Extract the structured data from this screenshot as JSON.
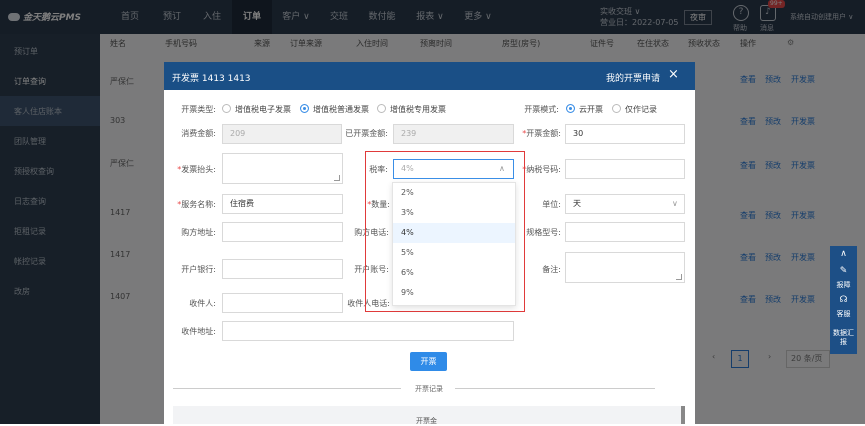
{
  "app": {
    "logo": "金天鹅云PMS"
  },
  "nav": [
    {
      "label": "首页"
    },
    {
      "label": "预订"
    },
    {
      "label": "入住"
    },
    {
      "label": "订单"
    },
    {
      "label": "客户 ∨"
    },
    {
      "label": "交班"
    },
    {
      "label": "数付能"
    },
    {
      "label": "报表 ∨"
    },
    {
      "label": "更多 ∨"
    }
  ],
  "topbar": {
    "biz_line1": "实收交班 ∨",
    "biz_line2": "营业日：2022-07-05",
    "night_audit": "夜审",
    "help_label": "帮助",
    "msg_label": "消息",
    "msg_badge": "99+",
    "user": "系统自动创建用户 ∨"
  },
  "sidebar": {
    "items": [
      "预订单",
      "订单查询",
      "客人住店账本",
      "团队管理",
      "预授权查询",
      "日志查询",
      "拒租记录",
      "帐控记录",
      "改房"
    ]
  },
  "table": {
    "headers": [
      "姓名",
      "手机号码",
      "来源",
      "订单来源",
      "入住时间",
      "预离时间",
      "房型(房号)",
      "证件号",
      "在住状态",
      "预收状态",
      "操作"
    ],
    "rows": [
      {
        "name": "严保仁",
        "room": ""
      },
      {
        "name": "",
        "room": "303"
      },
      {
        "name": "严保仁",
        "room": ""
      },
      {
        "name": "",
        "room": "1417"
      },
      {
        "name": "",
        "room": "1417"
      },
      {
        "name": "",
        "room": "1407"
      }
    ],
    "actions": [
      "查看",
      "预改",
      "开发票"
    ],
    "pager": {
      "page": "1",
      "size": "20 条/页"
    }
  },
  "modal": {
    "title": "开发票 1413 1413",
    "right_title": "我的开票申请",
    "close": "×",
    "invoice_type_label": "开票类型:",
    "invoice_types": [
      {
        "label": "增值税电子发票",
        "checked": false
      },
      {
        "label": "增值税普通发票",
        "checked": true
      },
      {
        "label": "增值税专用发票",
        "checked": false
      }
    ],
    "mode_label": "开票模式:",
    "modes": [
      {
        "label": "云开票",
        "checked": true
      },
      {
        "label": "仅作记录",
        "checked": false
      }
    ],
    "consume_label": "消费金额:",
    "consume_value": "209",
    "issued_label": "已开票金额:",
    "issued_value": "239",
    "amount_label": "开票金额:",
    "amount_value": "30",
    "title_label": "发票抬头:",
    "tax_rate_label": "税率:",
    "tax_rate_value": "4%",
    "taxpayer_label": "纳税号码:",
    "service_label": "服务名称:",
    "service_value": "住宿费",
    "qty_label": "数量:",
    "unit_label": "单位:",
    "unit_value": "天",
    "buyer_addr_label": "购方地址:",
    "buyer_phone_label": "购方电话:",
    "spec_label": "规格型号:",
    "bank_label": "开户银行:",
    "account_label": "开户账号:",
    "remark_label": "备注:",
    "recipient_label": "收件人:",
    "recipient_phone_label": "收件人电话:",
    "recipient_addr_label": "收件地址:",
    "submit": "开票",
    "records_title": "开票记录",
    "records_col": "开票金"
  },
  "tax_options": [
    "2%",
    "3%",
    "4%",
    "5%",
    "6%",
    "9%"
  ],
  "tax_selected": "4%",
  "float_tools": [
    {
      "icon": "∧",
      "label": ""
    },
    {
      "icon": "✎",
      "label": "报障"
    },
    {
      "icon": "☊",
      "label": "客服"
    },
    {
      "icon": "",
      "label": "数据汇报"
    }
  ],
  "colors": {
    "topbar": "#2b3a4d",
    "modal_header": "#1a4f86",
    "primary": "#2f8be8",
    "highlight": "#e03a3a"
  }
}
